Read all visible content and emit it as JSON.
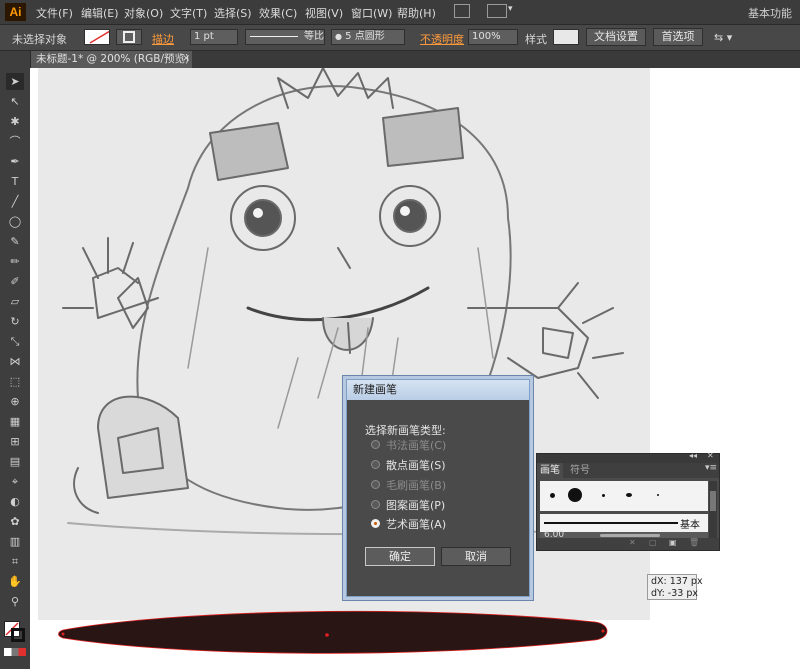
{
  "app": {
    "logo": "Ai",
    "workspace": "基本功能"
  },
  "menu": [
    "文件(F)",
    "编辑(E)",
    "对象(O)",
    "文字(T)",
    "选择(S)",
    "效果(C)",
    "视图(V)",
    "窗口(W)",
    "帮助(H)"
  ],
  "control": {
    "selection": "未选择对象",
    "stroke_label": "描边",
    "stroke_weight": "1 pt",
    "profile": "等比",
    "brush_def": "5 点圆形",
    "opacity_label": "不透明度",
    "opacity_value": "100%",
    "style_label": "样式",
    "doc_setup": "文档设置",
    "prefs": "首选项"
  },
  "document": {
    "tab_title": "未标题-1* @ 200% (RGB/预览)",
    "close": "×"
  },
  "dialog": {
    "title": "新建画笔",
    "prompt": "选择新画笔类型:",
    "options": [
      {
        "label": "书法画笔(C)",
        "enabled": false,
        "selected": false
      },
      {
        "label": "散点画笔(S)",
        "enabled": true,
        "selected": false
      },
      {
        "label": "毛刷画笔(B)",
        "enabled": false,
        "selected": false
      },
      {
        "label": "图案画笔(P)",
        "enabled": true,
        "selected": false
      },
      {
        "label": "艺术画笔(A)",
        "enabled": true,
        "selected": true
      }
    ],
    "ok": "确定",
    "cancel": "取消"
  },
  "brush_panel": {
    "tabs": [
      "画笔",
      "符号"
    ],
    "active_tab": "画笔",
    "basic_label": "基本",
    "size_label": "6.00"
  },
  "info": {
    "dx": "dX: 137 px",
    "dy": "dY: -33 px"
  },
  "colors": {
    "accent": "#ff9a3c",
    "shape_fill": "#2a1515",
    "anchor": "#e02020"
  }
}
